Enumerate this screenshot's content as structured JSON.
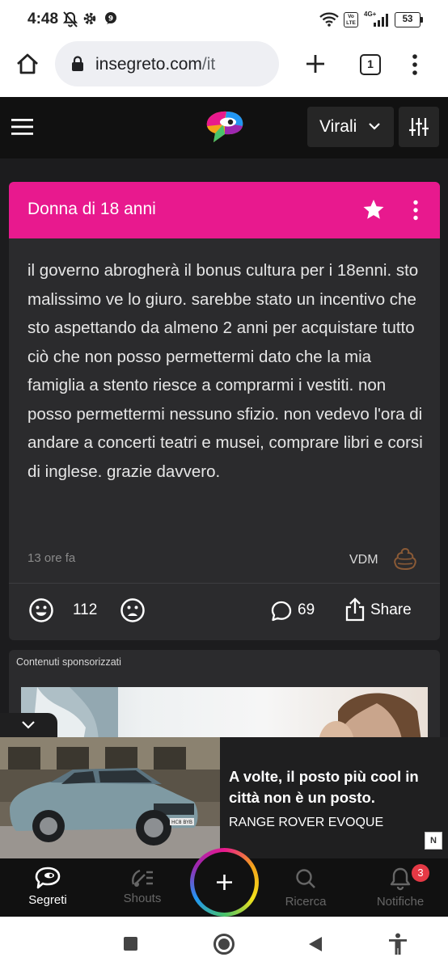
{
  "status_bar": {
    "time": "4:48",
    "battery": "53",
    "network": "4G+",
    "volte": "Vo LTE"
  },
  "browser": {
    "url_domain": "insegreto.com",
    "url_path": "/it",
    "tab_count": "1"
  },
  "header": {
    "filter_label": "Virali"
  },
  "post": {
    "author_label": "Donna di 18 anni",
    "body": "il governo abrogherà il bonus cultura per i 18enni. sto malissimo ve lo giuro. sarebbe stato un incentivo che sto aspettando da almeno 2 anni per acquistare tutto ciò che non posso permettermi dato che la mia famiglia a stento riesce a comprarmi i vestiti. non posso permettermi nessuno sfizio. non vedevo l'ora di andare a concerti teatri e musei, comprare libri e corsi di inglese. grazie davvero.",
    "time_ago": "13 ore fa",
    "tag": "VDM",
    "likes": "112",
    "comments": "69",
    "share_label": "Share"
  },
  "sponsored": {
    "label": "Contenuti sponsorizzati"
  },
  "ad": {
    "headline": "A volte, il posto più cool in città non è un posto.",
    "brand": "RANGE ROVER EVOQUE",
    "badge": "N",
    "plate": "HC8 BYB"
  },
  "bottom_nav": {
    "items": [
      {
        "label": "Segreti",
        "icon": "secret-bubble-icon",
        "active": true
      },
      {
        "label": "Shouts",
        "icon": "shout-icon",
        "active": false
      },
      {
        "label": "Ricerca",
        "icon": "search-icon",
        "active": false
      },
      {
        "label": "Notifiche",
        "icon": "bell-icon",
        "active": false
      }
    ],
    "notification_count": "3"
  },
  "colors": {
    "accent": "#e8198e",
    "background": "#1c1c1e",
    "card": "#2b2b2d"
  }
}
